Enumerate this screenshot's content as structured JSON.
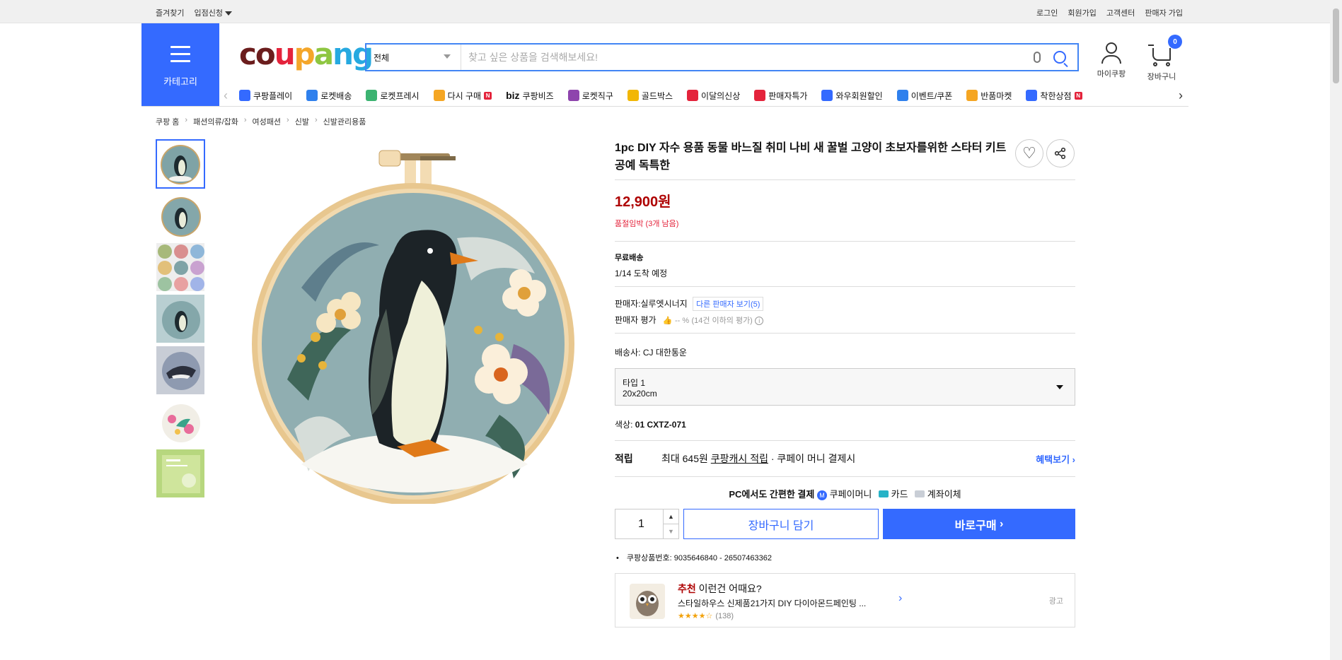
{
  "topbar": {
    "bookmark": "즐겨찾기",
    "store_apply": "입점신청",
    "login": "로그인",
    "signup": "회원가입",
    "support": "고객센터",
    "seller_signup": "판매자 가입"
  },
  "category": {
    "label": "카테고리"
  },
  "search": {
    "scope": "전체",
    "placeholder": "찾고 싶은 상품을 검색해보세요!"
  },
  "user": {
    "mycoupang": "마이쿠팡",
    "cart": "장바구니",
    "cart_count": "0"
  },
  "nav": {
    "items": [
      {
        "label": "쿠팡플레이",
        "color": "#346aff"
      },
      {
        "label": "로켓배송",
        "color": "#2f80ed"
      },
      {
        "label": "로켓프레시",
        "color": "#3cb371"
      },
      {
        "label": "다시 구매",
        "color": "#f5a623"
      },
      {
        "label": "쿠팡비즈",
        "prefix": "biz",
        "color": "#111111"
      },
      {
        "label": "로켓직구",
        "color": "#8e44ad"
      },
      {
        "label": "골드박스",
        "color": "#f2b705"
      },
      {
        "label": "이달의신상",
        "color": "#e4233b"
      },
      {
        "label": "판매자특가",
        "color": "#e4233b"
      },
      {
        "label": "와우회원할인",
        "color": "#346aff"
      },
      {
        "label": "이벤트/쿠폰",
        "color": "#2f80ed"
      },
      {
        "label": "반품마켓",
        "color": "#f5a623"
      },
      {
        "label": "착한상점",
        "color": "#346aff"
      }
    ],
    "badge_n": "N"
  },
  "breadcrumb": [
    "쿠팡 홈",
    "패션의류/잡화",
    "여성패션",
    "신발",
    "신발관리용품"
  ],
  "product": {
    "title": "1pc DIY 자수 용품 동물 바느질 취미 나비 새 꿀벌 고양이 초보자를위한 스타터 키트 공예 독특한",
    "price": "12,900원",
    "stock": "품절임박 (3개 남음)",
    "shipping_label": "무료배송",
    "arrival": "1/14 도착 예정",
    "seller_label": "판매자:",
    "seller_name": "실루엣시너지",
    "other_sellers": "다른 판매자 보기(5)",
    "seller_rating_label": "판매자 평가",
    "seller_rating_value": "-- %",
    "seller_rating_note": "(14건 이하의 평가)",
    "courier_label": "배송사:",
    "courier": "CJ 대한통운",
    "option_type": "타입 1",
    "option_size": "20x20cm",
    "color_label": "색상:",
    "color_value": "01 CXTZ-071",
    "reward_label": "적립",
    "reward_amount": "최대 645원",
    "reward_link": "쿠팡캐시 적립",
    "reward_tail": "· 쿠페이 머니 결제시",
    "reward_more": "혜택보기",
    "pay_lead": "PC에서도 간편한 결제",
    "pay_methods": [
      "쿠페이머니",
      "카드",
      "계좌이체"
    ],
    "quantity": "1",
    "add_to_cart": "장바구니 담기",
    "buy_now": "바로구매",
    "product_id_label": "쿠팡상품번호:",
    "product_id": "9035646840 - 26507463362"
  },
  "ad": {
    "recommend": "추천",
    "headline": "이런건 어때요?",
    "text": "스타일하우스 신제품21가지 DIY 다이아몬드페인팅 ...",
    "stars": "★★★★☆",
    "reviews": "(138)",
    "ad_label": "광고"
  }
}
